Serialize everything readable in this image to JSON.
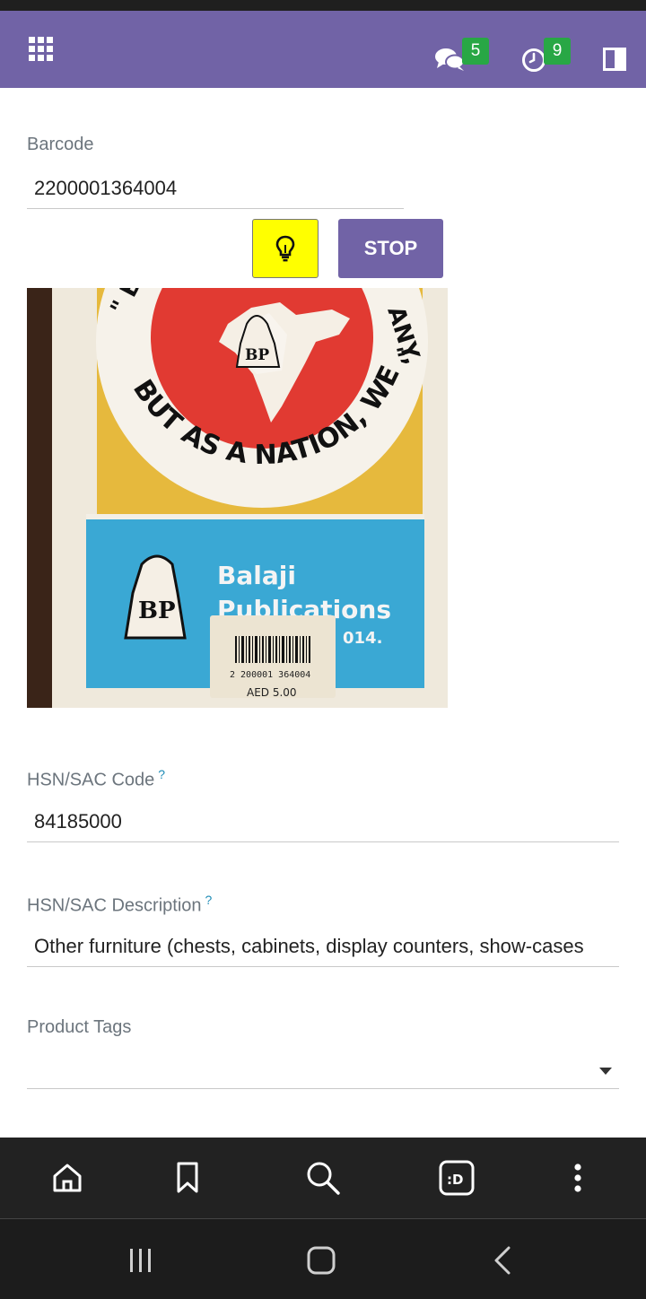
{
  "topbar": {
    "messages_badge": "5",
    "activities_badge": "9",
    "color": "#7163a6"
  },
  "form": {
    "barcode": {
      "label": "Barcode",
      "value": "2200001364004"
    },
    "scanner": {
      "flash_icon": "lightbulb-icon",
      "stop_label": "STOP"
    },
    "camera_view": {
      "book_text": {
        "slogan_top_left": "\" BY",
        "slogan_top_right": "ANY,",
        "slogan_bottom": "BUT AS A NATION, WE ARE ONE.",
        "close_quote": "\"",
        "logo": "BP",
        "publisher_line1": "Balaji",
        "publisher_line2": "Publications",
        "year_fragment": "014.",
        "sticker_barcode": "2 200001 364004",
        "sticker_price": "AED 5.00"
      }
    },
    "hsn_code": {
      "label": "HSN/SAC Code",
      "help": "?",
      "value": "84185000"
    },
    "hsn_description": {
      "label": "HSN/SAC Description",
      "help": "?",
      "value": "Other furniture (chests, cabinets, display counters, show-cases"
    },
    "product_tags": {
      "label": "Product Tags",
      "value": ""
    }
  },
  "browser_nav": {
    "items": [
      "home-icon",
      "bookmark-icon",
      "search-icon",
      "tab-switcher-icon",
      "menu-icon"
    ],
    "tab_label": ":D"
  },
  "system_nav": [
    "recents-icon",
    "home-icon",
    "back-icon"
  ]
}
